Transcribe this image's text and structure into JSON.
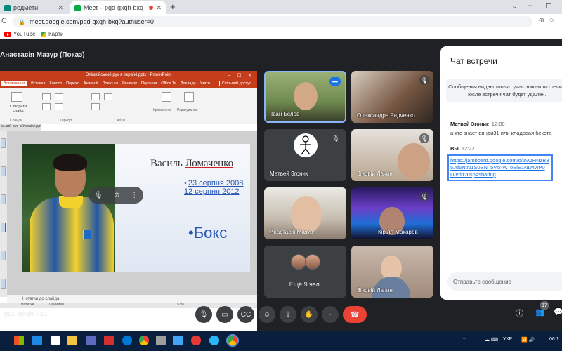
{
  "browser": {
    "tabs": [
      {
        "title": "редмети"
      },
      {
        "title": "Meet – pgd-gxqh-bxq",
        "close": "✕"
      }
    ],
    "close_label": "✕",
    "new_tab": "+",
    "window_controls": [
      "⌄",
      "–",
      "☐"
    ],
    "url": "meet.google.com/pgd-gxqh-bxq?authuser=0",
    "bookmarks": [
      "YouTube",
      "Карти"
    ]
  },
  "meet": {
    "presentation_title": "Анастасія Мазур (Показ)",
    "meeting_code": "pgd-gxqh-bxq",
    "participants_badge": "17"
  },
  "powerpoint": {
    "window_title": "Олімпійський рух в Україні.pptx - PowerPoint",
    "menu": [
      "Вставлення",
      "Вставка",
      "Констр",
      "Перехо",
      "Анімації",
      "Показ сл",
      "Рецензу",
      "Подання",
      "Office Ta",
      "Доклади",
      "Узяти",
      "Спільний доступ"
    ],
    "ribbon": {
      "new_slide": "Створити слайд",
      "groups": [
        "Слайди",
        "Шрифт",
        "Абзац",
        "Креслення",
        "Редагування"
      ]
    },
    "file_tab": "ський рух в Україні.pptx",
    "notes": "Нотатки до слайда",
    "status": [
      "Нотатки",
      "Примітки",
      "53%"
    ],
    "slide": {
      "name_first": "Василь ",
      "name_last": "Ломаченко",
      "date1": "23 серпня 2008",
      "date2": "12 серпня 2012",
      "sport": "•Бокс"
    }
  },
  "tiles": [
    {
      "name": "Іван Белов",
      "muted": false
    },
    {
      "name": "Олександра Радченко",
      "muted": true
    },
    {
      "name": "Матвей Згоник",
      "muted": true
    },
    {
      "name": "Зіновій Лачин",
      "muted": true
    },
    {
      "name": "Анастасія Мазур",
      "muted": false
    },
    {
      "name": "Кірілл Макаров",
      "muted": true
    },
    {
      "name": "Ещё 9 чел.",
      "muted": false
    },
    {
      "name": "Зіновій Лачин",
      "muted": false
    }
  ],
  "chat": {
    "title": "Чат встречи",
    "notice": "Сообщения видны только участникам встречи. После встречи чат будет удален.",
    "messages": [
      {
        "sender": "Матвей Згоник",
        "time": "12:00",
        "text": "а кто знает винди31 или кладовая бекста"
      },
      {
        "sender": "Вы",
        "time": "12:22",
        "text": "https://jamboard.google.com/d/1vOHNzB35Jd6NtN1S0SN_5Vlx-WToEiE1ND4wP0U/edit?usp=sharing"
      }
    ],
    "input_placeholder": "Отправьте сообщение"
  },
  "icons": {
    "mute": "mic-off-icon",
    "more": "more-vert-icon",
    "mic": "mic-icon",
    "cam": "camera-icon",
    "cc": "captions-icon",
    "emoji": "emoji-icon",
    "present": "present-icon",
    "hand": "raise-hand-icon",
    "end": "end-call-icon",
    "info": "info-icon",
    "people": "people-icon",
    "chat": "chat-icon"
  },
  "taskbar": {
    "tray_text": "УКР",
    "time": "06.1"
  },
  "colors": {
    "accent": "#1a73e8",
    "end_call": "#ea4335",
    "powerpoint": "#c43e1c"
  }
}
